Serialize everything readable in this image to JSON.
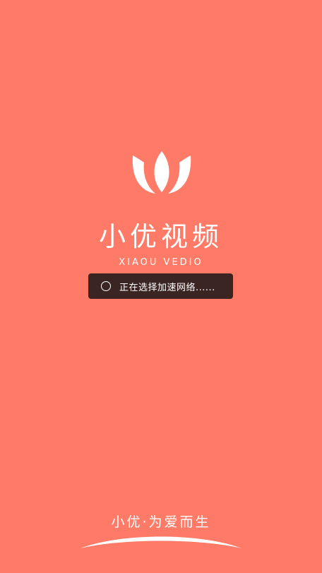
{
  "app": {
    "name_cn": "小优视频",
    "name_en": "XIAOU VEDIO",
    "logo": "lotus-logo-icon"
  },
  "toast": {
    "text": "正在选择加速网络......",
    "icon": "loading-spinner-icon"
  },
  "footer": {
    "slogan": "小优·为爱而生"
  },
  "colors": {
    "background": "#ff7a67",
    "toast_background": "#3a2522",
    "text": "#ffffff"
  }
}
